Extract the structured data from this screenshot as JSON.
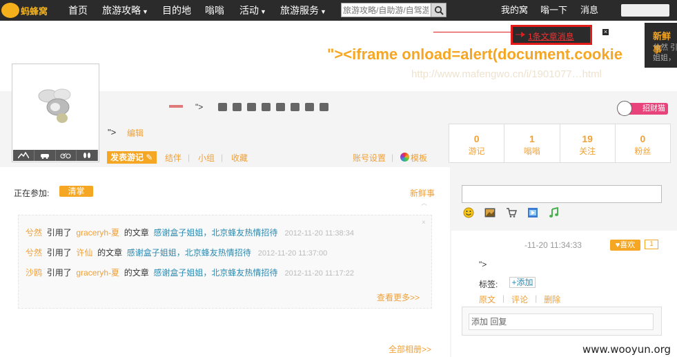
{
  "nav": {
    "items": [
      {
        "label": "首页",
        "caret": false
      },
      {
        "label": "旅游攻略",
        "caret": true
      },
      {
        "label": "目的地",
        "caret": false
      },
      {
        "label": "嗡嗡",
        "caret": false
      },
      {
        "label": "活动",
        "caret": true
      },
      {
        "label": "旅游服务",
        "caret": true
      }
    ],
    "search_placeholder": "旅游攻略/自助游/自驾游",
    "right": [
      "我的窝",
      "嗡一下",
      "消息"
    ]
  },
  "message_popup": {
    "text": "1条文章消息",
    "close": "×"
  },
  "fresh_box": {
    "title": "新鲜事",
    "line1": "兮然  引",
    "line2": "姐姐，"
  },
  "xss_text": "\"><iframe onload=alert(document.cookie",
  "blurred_url": "http://www.mafengwo.cn/i/1901077…html",
  "profile": {
    "name_suffix": "\">",
    "line2": "\">",
    "edit": "编辑",
    "post_button": "发表游记",
    "links": [
      "结伴",
      "小组",
      "收藏"
    ],
    "account": "账号设置",
    "template": "模板",
    "badge": "招财猫",
    "stats": [
      {
        "count": "0",
        "label": "游记"
      },
      {
        "count": "1",
        "label": "嗡嗡"
      },
      {
        "count": "19",
        "label": "关注"
      },
      {
        "count": "0",
        "label": "粉丝"
      }
    ]
  },
  "joining": {
    "label": "正在参加:",
    "tag": "清掌"
  },
  "fresh": {
    "title": "新鲜事",
    "rows": [
      {
        "user": "兮然",
        "verb": "引用了",
        "author": "graceryh-夏",
        "mid": "的文章",
        "article": "感谢盒子姐姐，北京蜂友热情招待",
        "time": "2012-11-20 11:38:34"
      },
      {
        "user": "兮然",
        "verb": "引用了",
        "author": "许仙",
        "mid": "的文章",
        "article": "感谢盒子姐姐，北京蜂友热情招待",
        "time": "2012-11-20 11:37:00"
      },
      {
        "user": "沙鸥",
        "verb": "引用了",
        "author": "graceryh-夏",
        "mid": "的文章",
        "article": "感谢盒子姐姐，北京蜂友热情招待",
        "time": "2012-11-20 11:17:22"
      }
    ],
    "more": "查看更多>>"
  },
  "album_link": "全部相册>>",
  "side_post": {
    "time": "-11-20 11:34:33",
    "like": "喜欢",
    "like_count": "1",
    "content": "\">",
    "tag_label": "标签:",
    "tag_add": "+添加",
    "actions": [
      "原文",
      "评论",
      "删除"
    ],
    "reply_placeholder": "添加  回复"
  },
  "watermark": "www.wooyun.org"
}
